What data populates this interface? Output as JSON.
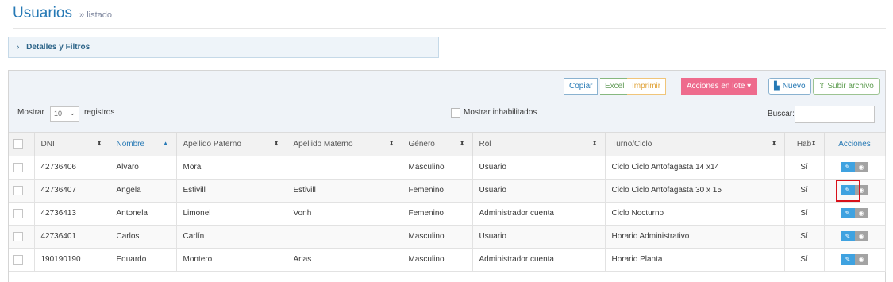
{
  "header": {
    "title": "Usuarios",
    "subtitle": "» listado"
  },
  "filters": {
    "label": "Detalles y Filtros",
    "icon": "chevron-right-icon"
  },
  "toolbar": {
    "copy": "Copiar",
    "excel": "Excel",
    "print": "Imprimir",
    "batch": "Acciones en lote ▾",
    "new": "Nuevo",
    "upload": "Subir archivo",
    "colors": {
      "batch": "#ee6b8d",
      "accent": "#2679b5"
    }
  },
  "listing": {
    "show_label": "Mostrar",
    "page_length": "10",
    "records_label": "registros",
    "show_disabled": "Mostrar inhabilitados",
    "search_label": "Buscar:",
    "search_value": ""
  },
  "table": {
    "headers": [
      "DNI",
      "Nombre",
      "Apellido Paterno",
      "Apellido Materno",
      "Género",
      "Rol",
      "Turno/Ciclo",
      "Hab",
      "Acciones"
    ],
    "rows": [
      [
        "42736406",
        "Alvaro",
        "Mora",
        "",
        "Masculino",
        "Usuario",
        "Ciclo Ciclo Antofagasta 14 x14",
        "Sí"
      ],
      [
        "42736407",
        "Angela",
        "Estivill",
        "Estivill",
        "Femenino",
        "Usuario",
        "Ciclo Ciclo Antofagasta 30 x 15",
        "Sí"
      ],
      [
        "42736413",
        "Antonela",
        "Limonel",
        "Vonh",
        "Femenino",
        "Administrador cuenta",
        "Ciclo Nocturno",
        "Sí"
      ],
      [
        "42736401",
        "Carlos",
        "Carlín",
        "",
        "Masculino",
        "Usuario",
        "Horario Administrativo",
        "Sí"
      ],
      [
        "190190190",
        "Eduardo",
        "Montero",
        "Arias",
        "Masculino",
        "Administrador cuenta",
        "Horario Planta",
        "Sí"
      ]
    ],
    "sorted_column": "Nombre",
    "action_icons": [
      "edit-icon",
      "eye-icon"
    ],
    "highlighted_row": 2
  }
}
